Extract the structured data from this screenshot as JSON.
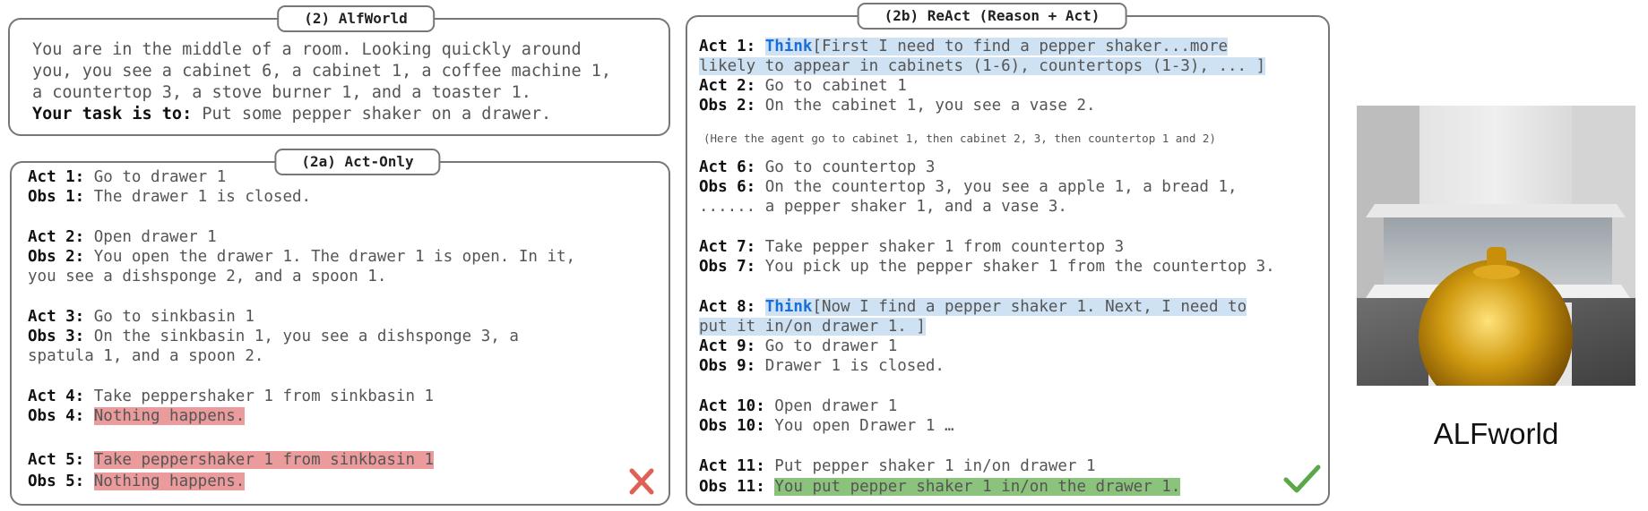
{
  "alfworld": {
    "title": "(2) AlfWorld",
    "lines": [
      "You are in the middle of a room. Looking quickly around",
      "you, you see a cabinet 6, a cabinet 1, a coffee machine 1,",
      "a countertop 3,  a stove burner 1, and a toaster 1."
    ],
    "task_label": "Your task is to:",
    "task_text": " Put some pepper shaker on a drawer."
  },
  "act_only": {
    "title": "(2a) Act-Only",
    "rows": [
      {
        "label": "Act 1:",
        "text": " Go to drawer 1"
      },
      {
        "label": "Obs 1:",
        "text": " The drawer 1 is closed."
      },
      {
        "label": "Act 2:",
        "text": " Open drawer 1"
      },
      {
        "label": "Obs 2:",
        "text": " You open the drawer 1. The drawer 1 is open. In it,"
      },
      {
        "label": "",
        "text": "you see a dishsponge 2, and a spoon 1."
      },
      {
        "label": "Act 3:",
        "text": " Go to sinkbasin 1"
      },
      {
        "label": "Obs 3:",
        "text": " On the sinkbasin 1, you see a dishsponge 3, a"
      },
      {
        "label": "",
        "text": "spatula 1, and a spoon 2."
      },
      {
        "label": "Act 4:",
        "text": " Take peppershaker 1 from sinkbasin 1"
      },
      {
        "label": "Obs 4:",
        "text": "Nothing happens."
      },
      {
        "label": "Act 5:",
        "text": "Take peppershaker 1 from sinkbasin 1"
      },
      {
        "label": "Obs 5:",
        "text": "Nothing happens."
      }
    ],
    "result_icon": "x-mark-icon",
    "result_color": "#e06055"
  },
  "react": {
    "title": "(2b) ReAct (Reason + Act)",
    "think_word": "Think",
    "rows": [
      {
        "label": "Act 1:",
        "text": "[First I need to find a pepper shaker...more"
      },
      {
        "label": "",
        "text": "likely to appear in cabinets (1-6), countertops (1-3), ... ]"
      },
      {
        "label": "Act 2:",
        "text": " Go to cabinet 1"
      },
      {
        "label": "Obs 2:",
        "text": " On the cabinet 1, you see a vase 2."
      },
      {
        "label": "Act 6:",
        "text": " Go to countertop 3"
      },
      {
        "label": "Obs 6:",
        "text": " On the countertop 3, you see a apple 1, a bread 1,"
      },
      {
        "label": "",
        "text": "...... a pepper shaker 1, and a vase 3."
      },
      {
        "label": "Act 7:",
        "text": " Take pepper shaker 1 from countertop 3"
      },
      {
        "label": "Obs 7:",
        "text": " You pick up the pepper shaker 1 from the countertop 3."
      },
      {
        "label": "Act 8:",
        "text": "[Now I find a pepper shaker 1. Next, I need to"
      },
      {
        "label": "",
        "text": "put it in/on drawer 1. ]"
      },
      {
        "label": "Act 9:",
        "text": " Go to drawer 1"
      },
      {
        "label": "Obs 9:",
        "text": " Drawer 1 is closed."
      },
      {
        "label": "Act 10:",
        "text": " Open drawer 1"
      },
      {
        "label": "Obs 10:",
        "text": " You open Drawer 1 …"
      },
      {
        "label": "Act 11:",
        "text": " Put pepper shaker 1 in/on drawer 1"
      },
      {
        "label": "Obs 11:",
        "text": "You put pepper shaker 1 in/on the drawer 1."
      }
    ],
    "note": "(Here the agent go to cabinet 1, then cabinet 2, 3, then countertop 1 and 2)",
    "result_icon": "check-mark-icon",
    "result_color": "#5aa84a"
  },
  "env": {
    "caption": "ALFworld",
    "image_icon": "pepper-shaker-scene-image"
  }
}
